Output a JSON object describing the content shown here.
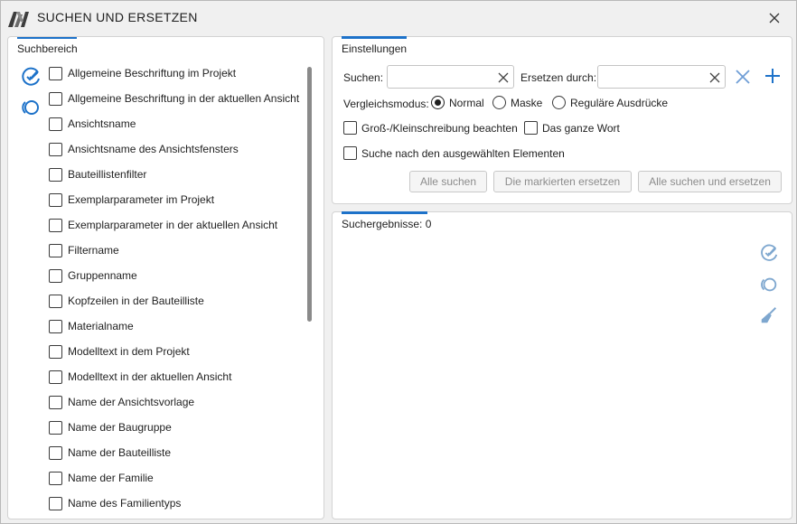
{
  "window": {
    "title": "SUCHEN UND ERSETZEN",
    "accent_color": "#1d72c9",
    "icon_color": "#7ea7cf"
  },
  "search_area": {
    "title": "Suchbereich",
    "items": [
      {
        "label": "Allgemeine Beschriftung im Projekt",
        "checked": false
      },
      {
        "label": "Allgemeine Beschriftung in der aktuellen Ansicht",
        "checked": false
      },
      {
        "label": "Ansichtsname",
        "checked": false
      },
      {
        "label": "Ansichtsname des Ansichtsfensters",
        "checked": false
      },
      {
        "label": "Bauteillistenfilter",
        "checked": false
      },
      {
        "label": "Exemplarparameter im Projekt",
        "checked": false
      },
      {
        "label": "Exemplarparameter in der aktuellen Ansicht",
        "checked": false
      },
      {
        "label": "Filtername",
        "checked": false
      },
      {
        "label": "Gruppenname",
        "checked": false
      },
      {
        "label": "Kopfzeilen in der Bauteilliste",
        "checked": false
      },
      {
        "label": "Materialname",
        "checked": false
      },
      {
        "label": "Modelltext in dem Projekt",
        "checked": false
      },
      {
        "label": "Modelltext in der aktuellen Ansicht",
        "checked": false
      },
      {
        "label": "Name der Ansichtsvorlage",
        "checked": false
      },
      {
        "label": "Name der Baugruppe",
        "checked": false
      },
      {
        "label": "Name der Bauteilliste",
        "checked": false
      },
      {
        "label": "Name der Familie",
        "checked": false
      },
      {
        "label": "Name des Familientyps",
        "checked": false
      }
    ]
  },
  "settings": {
    "title": "Einstellungen",
    "search_label": "Suchen:",
    "search_value": "",
    "replace_label": "Ersetzen durch:",
    "replace_value": "",
    "mode_label": "Vergleichsmodus:",
    "modes": [
      {
        "label": "Normal",
        "selected": true
      },
      {
        "label": "Maske",
        "selected": false
      },
      {
        "label": "Reguläre Ausdrücke",
        "selected": false
      }
    ],
    "options": [
      {
        "label": "Groß-/Kleinschreibung beachten",
        "checked": false
      },
      {
        "label": "Das ganze Wort",
        "checked": false
      },
      {
        "label": "Suche nach den ausgewählten Elementen",
        "checked": false
      }
    ],
    "buttons": {
      "find_all": "Alle suchen",
      "replace_marked": "Die markierten ersetzen",
      "find_replace_all": "Alle suchen und ersetzen"
    }
  },
  "results": {
    "label": "Suchergebnisse: 0"
  }
}
